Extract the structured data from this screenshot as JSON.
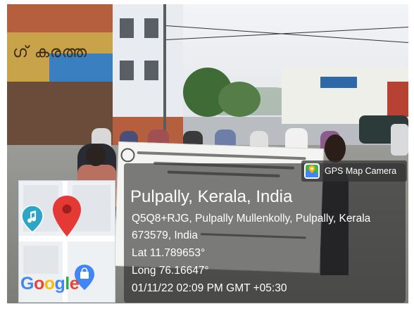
{
  "gps_camera": {
    "app_name": "GPS Map Camera",
    "icon": "gps-map-camera-app-icon"
  },
  "location": {
    "title": "Pulpally, Kerala, India",
    "address_line_1": "Q5Q8+RJG, Pulpally Mullenkolly, Pulpally, Kerala",
    "address_line_2": "673579, India",
    "latitude": "Lat 11.789653°",
    "longitude": "Long 76.16647°",
    "datetime": "01/11/22 02:09 PM GMT +05:30"
  },
  "map": {
    "brand": "Google",
    "brand_colors": [
      "#4285F4",
      "#EA4335",
      "#FBBC05",
      "#4285F4",
      "#34A853",
      "#EA4335"
    ],
    "pin_color": "#E53935",
    "music_marker_color": "#2CA5C9"
  },
  "photo": {
    "shop_sign_text": "ഗ് കരത്ത"
  }
}
